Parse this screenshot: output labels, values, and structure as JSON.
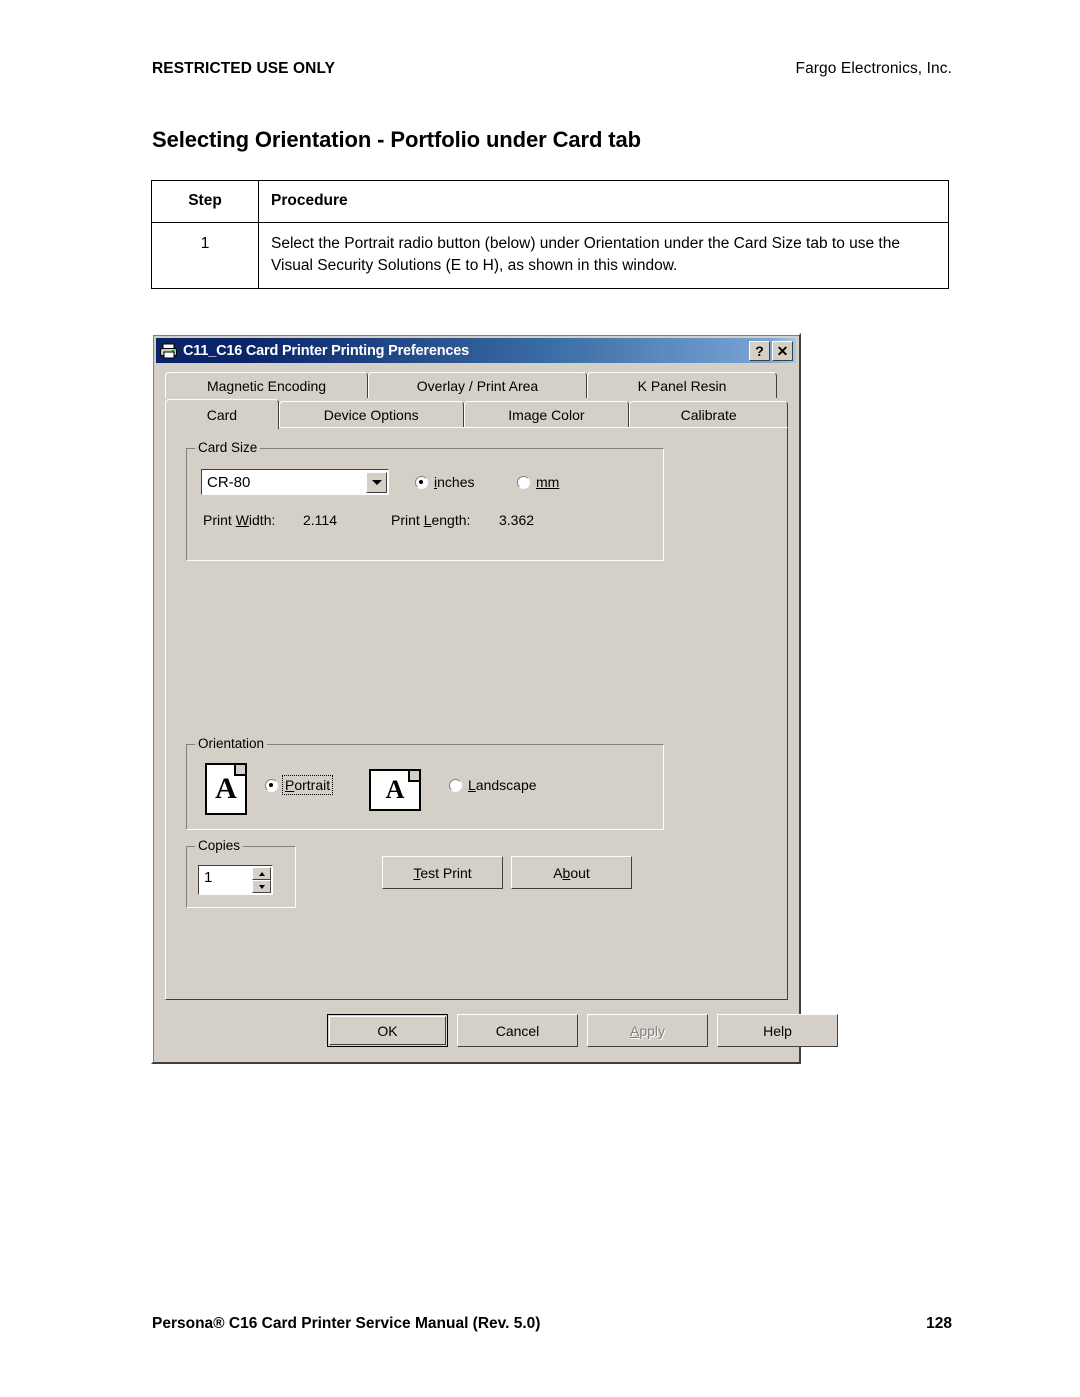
{
  "header": {
    "left": "RESTRICTED USE ONLY",
    "right": "Fargo Electronics, Inc."
  },
  "page_title": "Selecting Orientation - Portfolio under Card tab",
  "procedure_table": {
    "columns": [
      "Step",
      "Procedure"
    ],
    "rows": [
      {
        "step": "1",
        "procedure": "Select the Portrait radio button (below) under Orientation under the Card Size tab to use the Visual Security Solutions (E to H), as shown in this window."
      }
    ]
  },
  "dialog": {
    "title": "C11_C16 Card Printer Printing Preferences",
    "titlebar_icon": "printer-icon",
    "titlebar_buttons": {
      "help": "?",
      "close": "✕"
    },
    "tabs_row1": [
      {
        "label": "Magnetic Encoding",
        "active": false
      },
      {
        "label": "Overlay / Print Area",
        "active": false
      },
      {
        "label": "K Panel Resin",
        "active": false
      }
    ],
    "tabs_row2": [
      {
        "label": "Card",
        "active": true
      },
      {
        "label": "Device Options",
        "active": false
      },
      {
        "label": "Image Color",
        "active": false
      },
      {
        "label": "Calibrate",
        "active": false
      }
    ],
    "card_size": {
      "legend": "Card Size",
      "combo_value": "CR-80",
      "units": [
        {
          "label": "inches",
          "mnemonic": "i",
          "selected": true
        },
        {
          "label": "mm",
          "mnemonic": "m",
          "selected": false
        }
      ],
      "print_width_label": "Print Width:",
      "print_width_mnemonic": "W",
      "print_width_value": "2.114",
      "print_length_label": "Print Length:",
      "print_length_mnemonic": "L",
      "print_length_value": "3.362"
    },
    "orientation": {
      "legend": "Orientation",
      "options": [
        {
          "label": "Portrait",
          "mnemonic": "P",
          "selected": true,
          "icon": "portrait-page-icon",
          "glyph": "A"
        },
        {
          "label": "Landscape",
          "mnemonic": "L",
          "selected": false,
          "icon": "landscape-page-icon",
          "glyph": "A"
        }
      ]
    },
    "copies": {
      "legend": "Copies",
      "mnemonic": "C",
      "value": "1"
    },
    "action_buttons": [
      {
        "name": "test-print",
        "label": "Test Print",
        "mnemonic": "T",
        "disabled": false
      },
      {
        "name": "about",
        "label": "About",
        "mnemonic": "b",
        "disabled": false
      }
    ],
    "bottom_buttons": [
      {
        "name": "ok",
        "label": "OK",
        "default": true,
        "disabled": false
      },
      {
        "name": "cancel",
        "label": "Cancel",
        "default": false,
        "disabled": false
      },
      {
        "name": "apply",
        "label": "Apply",
        "mnemonic": "A",
        "default": false,
        "disabled": true
      },
      {
        "name": "help",
        "label": "Help",
        "default": false,
        "disabled": false
      }
    ]
  },
  "footer": {
    "left": "Persona® C16 Card Printer Service Manual (Rev. 5.0)",
    "right": "128"
  },
  "colors": {
    "dialog_face": "#d4d0c8",
    "titlebar_start": "#0a246a",
    "titlebar_end": "#a6c8ea",
    "text": "#000000",
    "disabled_text": "#808080"
  }
}
